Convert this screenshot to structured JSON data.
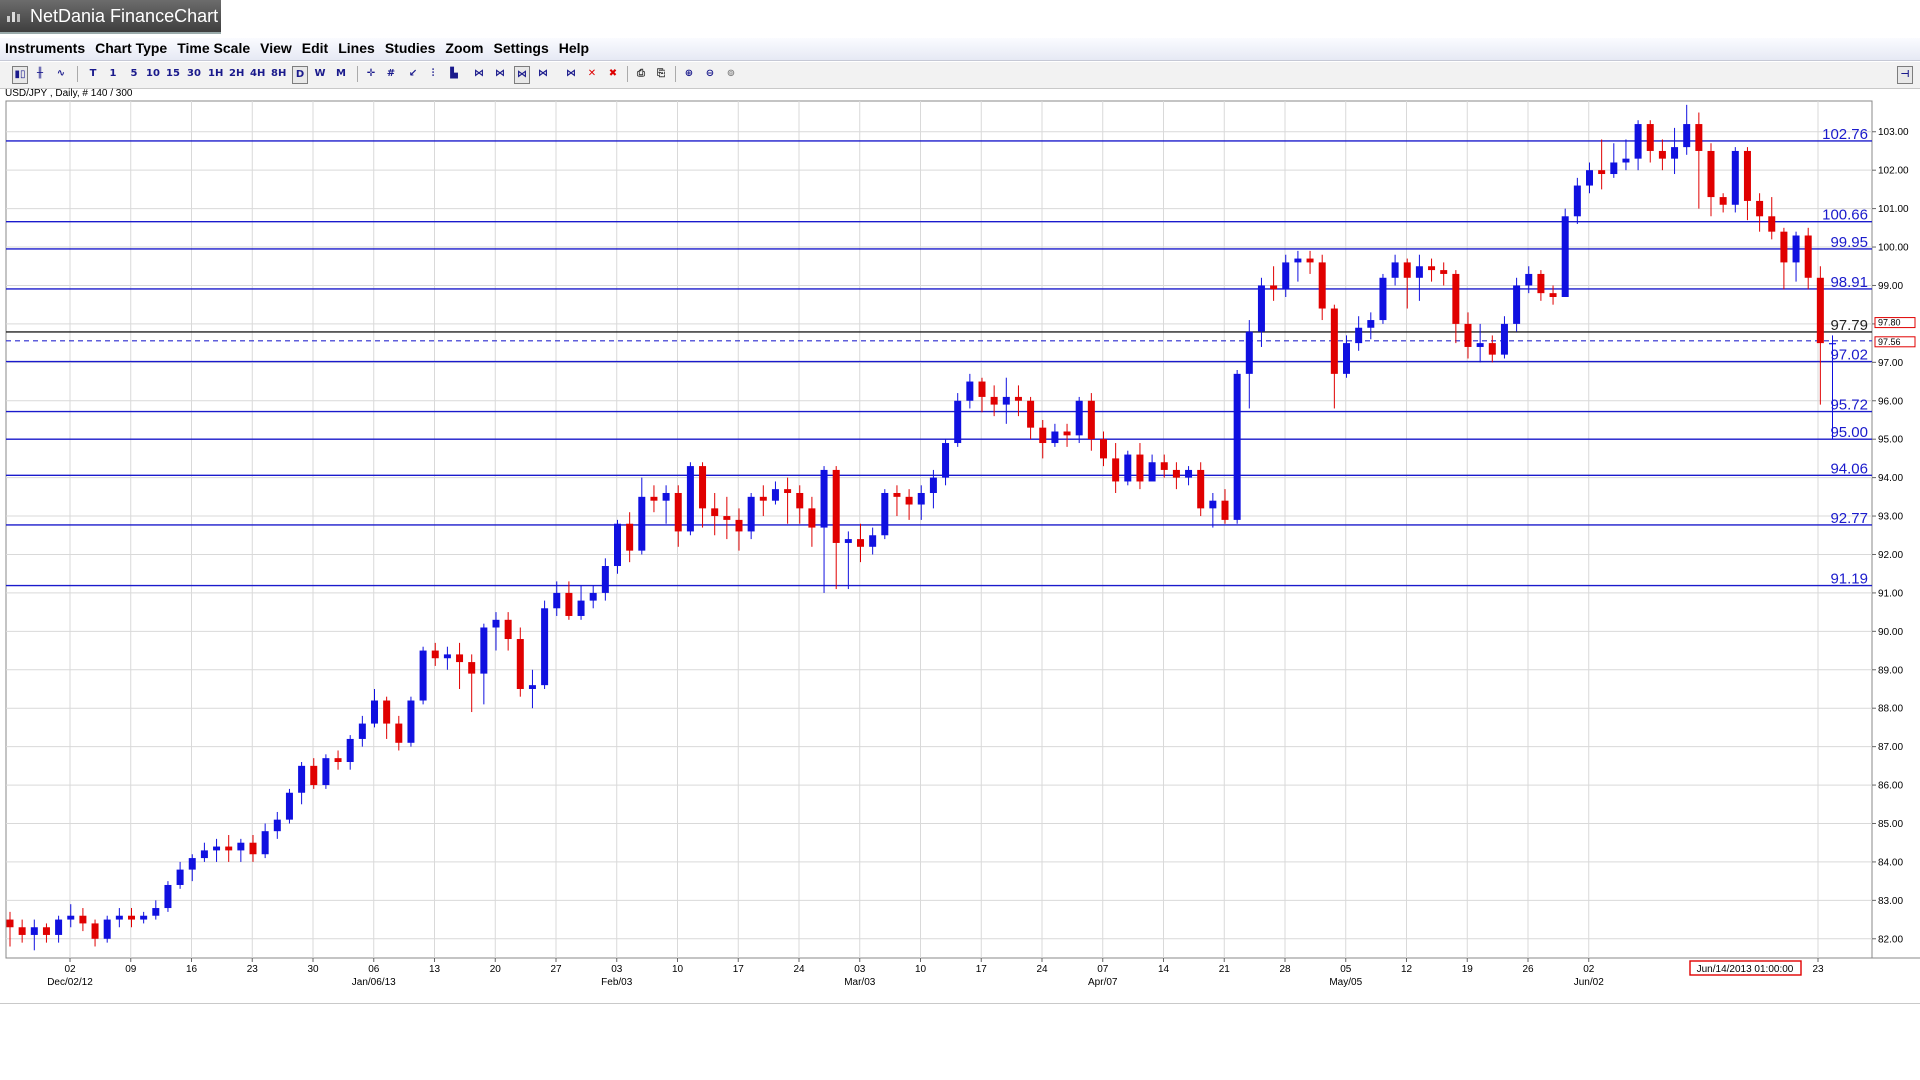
{
  "app": {
    "title": "NetDania FinanceChart"
  },
  "menu": [
    "Instruments",
    "Chart Type",
    "Time Scale",
    "View",
    "Edit",
    "Lines",
    "Studies",
    "Zoom",
    "Settings",
    "Help"
  ],
  "toolbar": {
    "timeframes": [
      "T",
      "1",
      "5",
      "10",
      "15",
      "30",
      "1H",
      "2H",
      "4H",
      "8H",
      "D",
      "W",
      "M"
    ],
    "selected": "D",
    "icons": [
      "candlestick-icon",
      "bar-chart-icon",
      "line-chart-icon",
      "crosshair-icon",
      "grid-icon",
      "trendline-icon",
      "volume-icon",
      "fibonacci-icon",
      "delete-icon",
      "delete-all-icon",
      "print-icon",
      "print-preview-icon",
      "zoom-in-icon",
      "zoom-out-icon",
      "zoom-reset-icon",
      "collapse-icon"
    ]
  },
  "chart_info": "USD/JPY , Daily, # 140 / 300",
  "chart_data": {
    "type": "candlestick",
    "symbol": "USD/JPY",
    "timeframe": "Daily",
    "ylim": [
      81.5,
      103.8
    ],
    "y_ticks": [
      "82.00",
      "83.00",
      "84.00",
      "85.00",
      "86.00",
      "87.00",
      "88.00",
      "89.00",
      "90.00",
      "91.00",
      "92.00",
      "93.00",
      "94.00",
      "95.00",
      "96.00",
      "97.00",
      "98.00",
      "99.00",
      "100.00",
      "101.00",
      "102.00",
      "103.00"
    ],
    "x_ticks": [
      {
        "day": "02",
        "month": "Dec/02/12"
      },
      {
        "day": "09",
        "month": ""
      },
      {
        "day": "16",
        "month": ""
      },
      {
        "day": "23",
        "month": ""
      },
      {
        "day": "30",
        "month": ""
      },
      {
        "day": "06",
        "month": "Jan/06/13"
      },
      {
        "day": "13",
        "month": ""
      },
      {
        "day": "20",
        "month": ""
      },
      {
        "day": "27",
        "month": ""
      },
      {
        "day": "03",
        "month": "Feb/03"
      },
      {
        "day": "10",
        "month": ""
      },
      {
        "day": "17",
        "month": ""
      },
      {
        "day": "24",
        "month": ""
      },
      {
        "day": "03",
        "month": "Mar/03"
      },
      {
        "day": "10",
        "month": ""
      },
      {
        "day": "17",
        "month": ""
      },
      {
        "day": "24",
        "month": ""
      },
      {
        "day": "07",
        "month": "Apr/07"
      },
      {
        "day": "14",
        "month": ""
      },
      {
        "day": "21",
        "month": ""
      },
      {
        "day": "28",
        "month": ""
      },
      {
        "day": "05",
        "month": "May/05"
      },
      {
        "day": "12",
        "month": ""
      },
      {
        "day": "19",
        "month": ""
      },
      {
        "day": "26",
        "month": ""
      },
      {
        "day": "02",
        "month": "Jun/02"
      },
      {
        "day": "23",
        "month": ""
      }
    ],
    "crosshair_date": "Jun/14/2013 01:00:00",
    "levels": [
      {
        "label": "102.76",
        "value": 102.76
      },
      {
        "label": "100.66",
        "value": 100.66
      },
      {
        "label": "99.95",
        "value": 99.95
      },
      {
        "label": "98.91",
        "value": 98.91
      },
      {
        "label": "97.79",
        "value": 97.79
      },
      {
        "label": "97.02",
        "value": 97.02
      },
      {
        "label": "95.72",
        "value": 95.72
      },
      {
        "label": "95.00",
        "value": 95.0
      },
      {
        "label": "94.06",
        "value": 94.06
      },
      {
        "label": "92.77",
        "value": 92.77
      },
      {
        "label": "91.19",
        "value": 91.19
      }
    ],
    "current_price": {
      "label": "97.56",
      "value": 97.56
    },
    "cursor_price": {
      "label": "97.80",
      "value": 97.8
    },
    "colors": {
      "up": "#1010e0",
      "down": "#e00000",
      "level": "#1a1acc",
      "grid": "#d9d9d9"
    },
    "candles": [
      [
        82.5,
        82.3,
        82.7,
        81.8
      ],
      [
        82.3,
        82.1,
        82.5,
        81.9
      ],
      [
        82.1,
        82.3,
        82.5,
        81.7
      ],
      [
        82.3,
        82.1,
        82.4,
        81.9
      ],
      [
        82.1,
        82.5,
        82.6,
        81.9
      ],
      [
        82.5,
        82.6,
        82.9,
        82.3
      ],
      [
        82.6,
        82.4,
        82.8,
        82.2
      ],
      [
        82.4,
        82.0,
        82.5,
        81.8
      ],
      [
        82.0,
        82.5,
        82.6,
        81.9
      ],
      [
        82.5,
        82.6,
        82.8,
        82.3
      ],
      [
        82.6,
        82.5,
        82.8,
        82.3
      ],
      [
        82.5,
        82.6,
        82.7,
        82.4
      ],
      [
        82.6,
        82.8,
        83.0,
        82.5
      ],
      [
        82.8,
        83.4,
        83.5,
        82.7
      ],
      [
        83.4,
        83.8,
        84.0,
        83.3
      ],
      [
        83.8,
        84.1,
        84.2,
        83.5
      ],
      [
        84.1,
        84.3,
        84.5,
        84.0
      ],
      [
        84.3,
        84.4,
        84.6,
        84.0
      ],
      [
        84.4,
        84.3,
        84.7,
        84.0
      ],
      [
        84.3,
        84.5,
        84.6,
        84.0
      ],
      [
        84.5,
        84.2,
        84.7,
        84.0
      ],
      [
        84.2,
        84.8,
        85.0,
        84.1
      ],
      [
        84.8,
        85.1,
        85.3,
        84.6
      ],
      [
        85.1,
        85.8,
        85.9,
        85.0
      ],
      [
        85.8,
        86.5,
        86.6,
        85.5
      ],
      [
        86.5,
        86.0,
        86.7,
        85.9
      ],
      [
        86.0,
        86.7,
        86.8,
        85.9
      ],
      [
        86.7,
        86.6,
        86.9,
        86.4
      ],
      [
        86.6,
        87.2,
        87.3,
        86.4
      ],
      [
        87.2,
        87.6,
        87.8,
        87.0
      ],
      [
        87.6,
        88.2,
        88.5,
        87.5
      ],
      [
        88.2,
        87.6,
        88.3,
        87.2
      ],
      [
        87.6,
        87.1,
        87.8,
        86.9
      ],
      [
        87.1,
        88.2,
        88.3,
        87.0
      ],
      [
        88.2,
        89.5,
        89.6,
        88.1
      ],
      [
        89.5,
        89.3,
        89.7,
        89.1
      ],
      [
        89.3,
        89.4,
        89.6,
        89.0
      ],
      [
        89.4,
        89.2,
        89.7,
        88.5
      ],
      [
        89.2,
        88.9,
        89.4,
        87.9
      ],
      [
        88.9,
        90.1,
        90.2,
        88.1
      ],
      [
        90.1,
        90.3,
        90.5,
        89.5
      ],
      [
        90.3,
        89.8,
        90.5,
        89.5
      ],
      [
        89.8,
        88.5,
        90.1,
        88.3
      ],
      [
        88.5,
        88.6,
        89.0,
        88.0
      ],
      [
        88.6,
        90.6,
        90.8,
        88.5
      ],
      [
        90.6,
        91.0,
        91.3,
        90.4
      ],
      [
        91.0,
        90.4,
        91.3,
        90.3
      ],
      [
        90.4,
        90.8,
        91.2,
        90.3
      ],
      [
        90.8,
        91.0,
        91.2,
        90.6
      ],
      [
        91.0,
        91.7,
        91.9,
        90.8
      ],
      [
        91.7,
        92.8,
        92.9,
        91.5
      ],
      [
        92.8,
        92.1,
        93.1,
        91.8
      ],
      [
        92.1,
        93.5,
        94.0,
        92.0
      ],
      [
        93.5,
        93.4,
        93.8,
        93.1
      ],
      [
        93.4,
        93.6,
        93.8,
        92.8
      ],
      [
        93.6,
        92.6,
        93.8,
        92.2
      ],
      [
        92.6,
        94.3,
        94.4,
        92.5
      ],
      [
        94.3,
        93.2,
        94.4,
        92.7
      ],
      [
        93.2,
        93.0,
        93.6,
        92.5
      ],
      [
        93.0,
        92.9,
        93.5,
        92.4
      ],
      [
        92.9,
        92.6,
        93.2,
        92.1
      ],
      [
        92.6,
        93.5,
        93.6,
        92.4
      ],
      [
        93.5,
        93.4,
        93.8,
        93.0
      ],
      [
        93.4,
        93.7,
        93.9,
        93.3
      ],
      [
        93.7,
        93.6,
        94.0,
        92.8
      ],
      [
        93.6,
        93.2,
        93.8,
        92.8
      ],
      [
        93.2,
        92.7,
        93.5,
        92.2
      ],
      [
        92.7,
        94.2,
        94.3,
        91.0
      ],
      [
        94.2,
        92.3,
        94.3,
        91.1
      ],
      [
        92.3,
        92.4,
        92.6,
        91.1
      ],
      [
        92.4,
        92.2,
        92.8,
        91.8
      ],
      [
        92.2,
        92.5,
        92.7,
        92.0
      ],
      [
        92.5,
        93.6,
        93.7,
        92.4
      ],
      [
        93.6,
        93.5,
        93.8,
        93.0
      ],
      [
        93.5,
        93.3,
        93.7,
        92.9
      ],
      [
        93.3,
        93.6,
        93.8,
        92.9
      ],
      [
        93.6,
        94.0,
        94.2,
        93.2
      ],
      [
        94.0,
        94.9,
        95.0,
        93.8
      ],
      [
        94.9,
        96.0,
        96.2,
        94.8
      ],
      [
        96.0,
        96.5,
        96.7,
        95.8
      ],
      [
        96.5,
        96.1,
        96.6,
        95.7
      ],
      [
        96.1,
        95.9,
        96.4,
        95.6
      ],
      [
        95.9,
        96.1,
        96.6,
        95.4
      ],
      [
        96.1,
        96.0,
        96.4,
        95.6
      ],
      [
        96.0,
        95.3,
        96.1,
        95.0
      ],
      [
        95.3,
        94.9,
        95.5,
        94.5
      ],
      [
        94.9,
        95.2,
        95.4,
        94.8
      ],
      [
        95.2,
        95.1,
        95.4,
        94.8
      ],
      [
        95.1,
        96.0,
        96.1,
        94.9
      ],
      [
        96.0,
        95.0,
        96.2,
        94.7
      ],
      [
        95.0,
        94.5,
        95.2,
        94.3
      ],
      [
        94.5,
        93.9,
        94.9,
        93.6
      ],
      [
        93.9,
        94.6,
        94.7,
        93.8
      ],
      [
        94.6,
        93.9,
        94.9,
        93.7
      ],
      [
        93.9,
        94.4,
        94.6,
        94.0
      ],
      [
        94.4,
        94.2,
        94.6,
        94.0
      ],
      [
        94.2,
        94.0,
        94.4,
        93.7
      ],
      [
        94.0,
        94.2,
        94.3,
        93.8
      ],
      [
        94.2,
        93.2,
        94.4,
        93.0
      ],
      [
        93.2,
        93.4,
        93.6,
        92.7
      ],
      [
        93.4,
        92.9,
        93.7,
        92.8
      ],
      [
        92.9,
        96.7,
        96.8,
        92.8
      ],
      [
        96.7,
        97.8,
        98.1,
        95.8
      ],
      [
        97.8,
        99.0,
        99.2,
        97.4
      ],
      [
        99.0,
        98.9,
        99.5,
        98.6
      ],
      [
        98.9,
        99.6,
        99.8,
        98.7
      ],
      [
        99.6,
        99.7,
        99.9,
        99.1
      ],
      [
        99.7,
        99.6,
        99.9,
        99.3
      ],
      [
        99.6,
        98.4,
        99.8,
        98.1
      ],
      [
        98.4,
        96.7,
        98.5,
        95.8
      ],
      [
        96.7,
        97.5,
        97.7,
        96.6
      ],
      [
        97.5,
        97.9,
        98.2,
        97.3
      ],
      [
        97.9,
        98.1,
        98.3,
        97.6
      ],
      [
        98.1,
        99.2,
        99.3,
        98.0
      ],
      [
        99.2,
        99.6,
        99.8,
        99.0
      ],
      [
        99.6,
        99.2,
        99.7,
        98.4
      ],
      [
        99.2,
        99.5,
        99.8,
        98.6
      ],
      [
        99.5,
        99.4,
        99.7,
        99.1
      ],
      [
        99.4,
        99.3,
        99.6,
        99.0
      ],
      [
        99.3,
        98.0,
        99.4,
        97.5
      ],
      [
        98.0,
        97.4,
        98.3,
        97.1
      ],
      [
        97.4,
        97.5,
        98.0,
        97.0
      ],
      [
        97.5,
        97.2,
        97.7,
        97.0
      ],
      [
        97.2,
        98.0,
        98.2,
        97.1
      ],
      [
        98.0,
        99.0,
        99.2,
        97.8
      ],
      [
        99.0,
        99.3,
        99.5,
        98.8
      ],
      [
        99.3,
        98.8,
        99.4,
        98.6
      ],
      [
        98.8,
        98.7,
        99.0,
        98.5
      ],
      [
        98.7,
        100.8,
        101.0,
        98.7
      ],
      [
        100.8,
        101.6,
        101.8,
        100.6
      ],
      [
        101.6,
        102.0,
        102.2,
        101.4
      ],
      [
        102.0,
        101.9,
        102.8,
        101.5
      ],
      [
        101.9,
        102.2,
        102.7,
        101.8
      ],
      [
        102.2,
        102.3,
        102.8,
        102.0
      ],
      [
        102.3,
        103.2,
        103.3,
        102.0
      ],
      [
        103.2,
        102.5,
        103.3,
        102.2
      ],
      [
        102.5,
        102.3,
        102.8,
        102.0
      ],
      [
        102.3,
        102.6,
        103.1,
        101.9
      ],
      [
        102.6,
        103.2,
        103.7,
        102.4
      ],
      [
        103.2,
        102.5,
        103.5,
        101.0
      ],
      [
        102.5,
        101.3,
        102.7,
        100.8
      ],
      [
        101.3,
        101.1,
        101.4,
        100.9
      ],
      [
        101.1,
        102.5,
        102.6,
        100.9
      ],
      [
        102.5,
        101.2,
        102.6,
        100.7
      ],
      [
        101.2,
        100.8,
        101.4,
        100.4
      ],
      [
        100.8,
        100.4,
        101.3,
        100.2
      ],
      [
        100.4,
        99.6,
        100.5,
        98.9
      ],
      [
        99.6,
        100.3,
        100.4,
        99.1
      ],
      [
        100.3,
        99.2,
        100.5,
        98.9
      ],
      [
        99.2,
        97.5,
        99.5,
        95.9
      ],
      [
        97.5,
        97.5,
        97.7,
        95.0
      ]
    ]
  }
}
